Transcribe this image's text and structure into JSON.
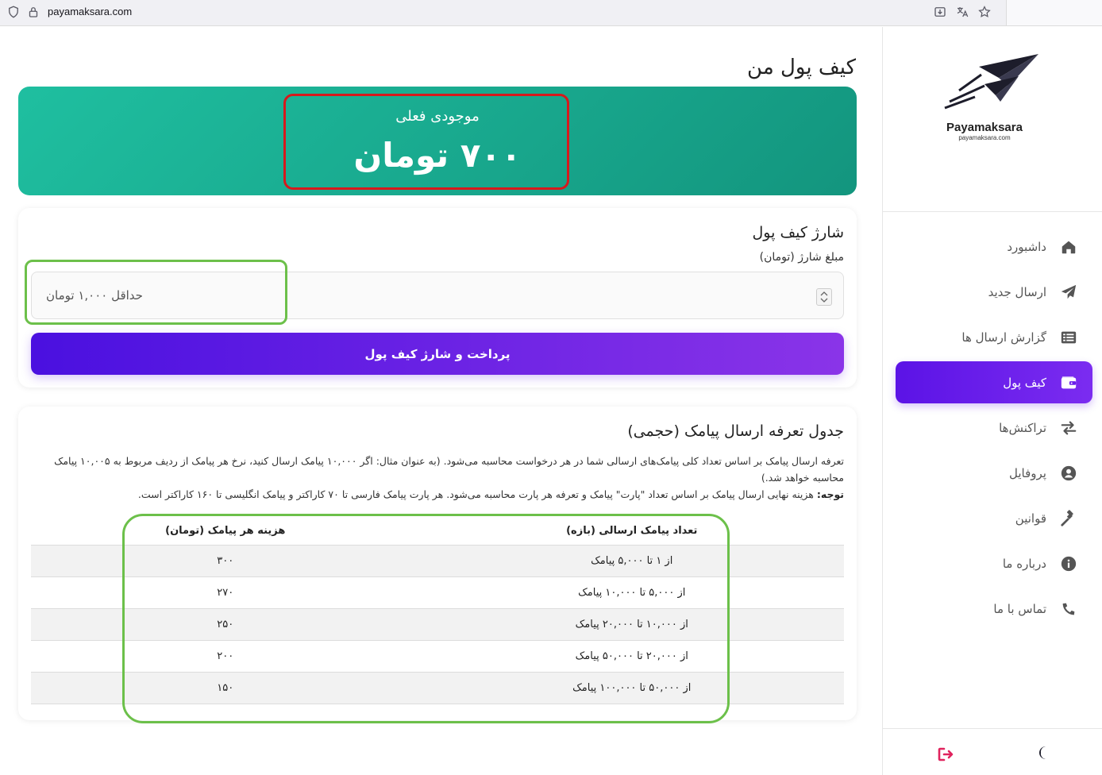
{
  "browser": {
    "url": "payamaksara.com"
  },
  "sidebar": {
    "brand_name": "Payamaksara",
    "brand_url": "payamaksara.com",
    "items": [
      {
        "label": "داشبورد",
        "icon": "home-icon",
        "active": false
      },
      {
        "label": "ارسال جدید",
        "icon": "paper-plane-icon",
        "active": false
      },
      {
        "label": "گزارش ارسال ها",
        "icon": "list-icon",
        "active": false
      },
      {
        "label": "کیف پول",
        "icon": "wallet-icon",
        "active": true
      },
      {
        "label": "تراکنش‌ها",
        "icon": "exchange-icon",
        "active": false
      },
      {
        "label": "پروفایل",
        "icon": "user-circle-icon",
        "active": false
      },
      {
        "label": "قوانین",
        "icon": "gavel-icon",
        "active": false
      },
      {
        "label": "درباره ما",
        "icon": "info-icon",
        "active": false
      },
      {
        "label": "تماس با ما",
        "icon": "phone-icon",
        "active": false
      }
    ]
  },
  "main": {
    "title": "کیف پول من",
    "balance": {
      "label": "موجودی فعلی",
      "value": "۷۰۰ تومان"
    },
    "charge": {
      "title": "شارژ کیف پول",
      "amount_label": "مبلغ شارژ (تومان)",
      "amount_placeholder": "حداقل ۱,۰۰۰ تومان",
      "pay_button": "پرداخت و شارژ کیف پول"
    },
    "tariff": {
      "title": "جدول تعرفه ارسال پیامک (حجمی)",
      "description": "تعرفه ارسال پیامک بر اساس تعداد کلی پیامک‌های ارسالی شما در هر درخواست محاسبه می‌شود. (به عنوان مثال: اگر ۱۰,۰۰۰ پیامک ارسال کنید، نرخ هر پیامک از ردیف مربوط به ۱۰,۰۰۵ پیامک محاسبه خواهد شد.)",
      "note_label": "توجه:",
      "note_text": " هزینه نهایی ارسال پیامک بر اساس تعداد \"پارت\" پیامک و تعرفه هر پارت محاسبه می‌شود. هر پارت پیامک فارسی تا ۷۰ کاراکتر و پیامک انگلیسی تا ۱۶۰ کاراکتر است.",
      "columns": [
        "تعداد پیامک ارسالی (بازه)",
        "هزینه هر پیامک (تومان)"
      ],
      "rows": [
        {
          "range": "از ۱ تا ۵,۰۰۰ پیامک",
          "cost": "۳۰۰"
        },
        {
          "range": "از ۵,۰۰۰ تا ۱۰,۰۰۰ پیامک",
          "cost": "۲۷۰"
        },
        {
          "range": "از ۱۰,۰۰۰ تا ۲۰,۰۰۰ پیامک",
          "cost": "۲۵۰"
        },
        {
          "range": "از ۲۰,۰۰۰ تا ۵۰,۰۰۰ پیامک",
          "cost": "۲۰۰"
        },
        {
          "range": "از ۵۰,۰۰۰ تا ۱۰۰,۰۰۰ پیامک",
          "cost": "۱۵۰"
        }
      ]
    }
  },
  "colors": {
    "accent": "#5b13e6",
    "balance_card": "#1ab394",
    "highlight_red": "#d7191c",
    "highlight_green": "#6cc04a"
  }
}
